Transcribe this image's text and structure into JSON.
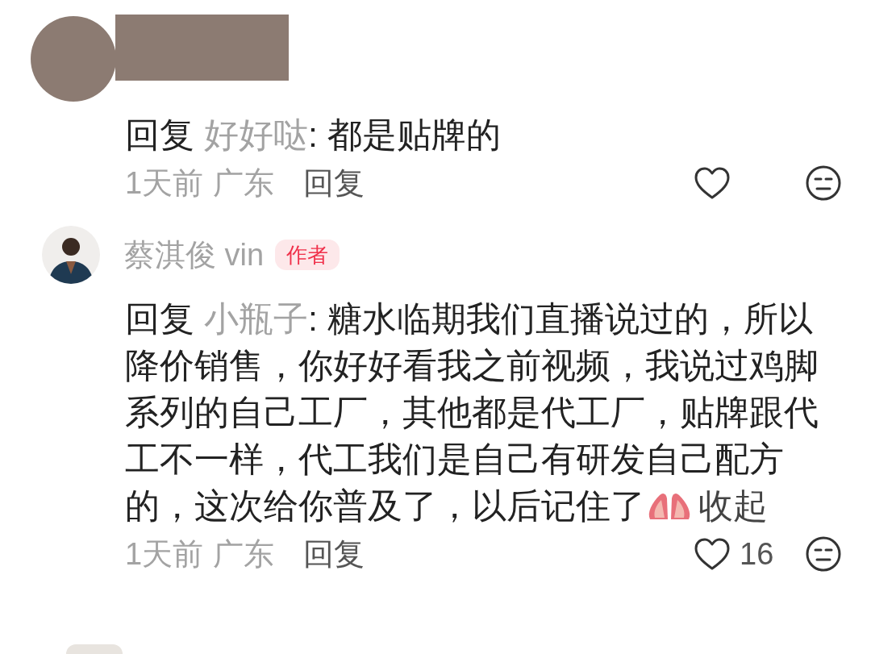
{
  "comments": [
    {
      "kind": "redacted",
      "reply_label": "回复",
      "reply_to": "好好哒",
      "text": ": 都是贴牌的",
      "time": "1天前",
      "location": "广东",
      "reply_button": "回复",
      "liked": false
    },
    {
      "kind": "named",
      "username": "蔡淇俊 vin",
      "is_author": true,
      "author_badge": "作者",
      "reply_label": "回复",
      "reply_to": "小瓶子",
      "text": ": 糖水临期我们直播说过的，所以降价销售，你好好看我之前视频，我说过鸡脚系列的自己工厂，其他都是代工厂，贴牌跟代工不一样，代工我们是自己有研发自己配方的，这次给你普及了，以后记住了",
      "collapse": "收起",
      "time": "1天前",
      "location": "广东",
      "reply_button": "回复",
      "liked": false,
      "like_count": "16"
    }
  ]
}
